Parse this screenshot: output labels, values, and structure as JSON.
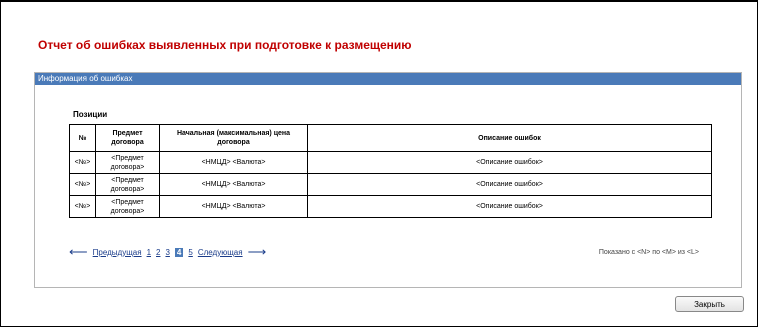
{
  "report": {
    "title": "Отчет об ошибках выявленных при подготовке к размещению"
  },
  "panel": {
    "header": "Информация об ошибках",
    "section_label": "Позиции",
    "columns": [
      "№",
      "Предмет договора",
      "Начальная (максимальная) цена договора",
      "Описание ошибок"
    ],
    "rows": [
      [
        "<№>",
        "<Предмет договора>",
        "<НМЦД> <Валюта>",
        "<Описание ошибок>"
      ],
      [
        "<№>",
        "<Предмет договора>",
        "<НМЦД> <Валюта>",
        "<Описание ошибок>"
      ],
      [
        "<№>",
        "<Предмет договора>",
        "<НМЦД> <Валюта>",
        "<Описание ошибок>"
      ]
    ]
  },
  "pagination": {
    "prev_label": "Предыдущая",
    "next_label": "Следующая",
    "pages": [
      "1",
      "2",
      "3",
      "4",
      "5"
    ],
    "current_page": "4",
    "shown_text": "Показано с <N> по <M> из <L>"
  },
  "actions": {
    "close_label": "Закрыть"
  },
  "colors": {
    "title": "#c00000",
    "header_bg": "#4a7ab8",
    "link": "#1a3c8a"
  }
}
